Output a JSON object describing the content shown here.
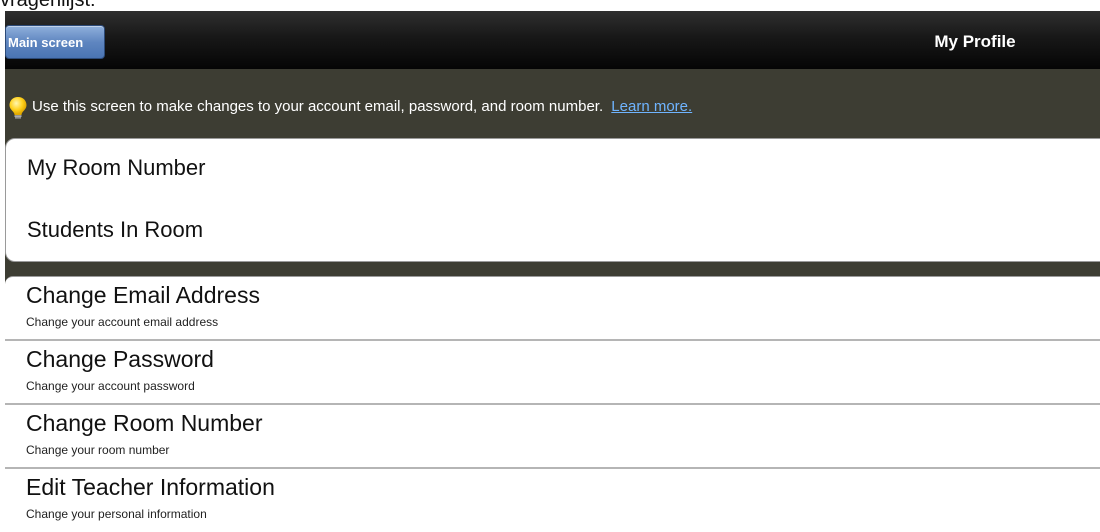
{
  "page_caption": "vragenlijst:",
  "nav": {
    "back_label": "Main screen",
    "title": "My Profile"
  },
  "info": {
    "text": "Use this screen to make changes to your account email, password, and room number.",
    "link": "Learn more.",
    "icon": "lightbulb-icon"
  },
  "room_group": {
    "rows": [
      {
        "label": "My Room Number"
      },
      {
        "label": "Students In Room"
      }
    ]
  },
  "settings": {
    "items": [
      {
        "title": "Change Email Address",
        "subtitle": "Change your account email address"
      },
      {
        "title": "Change Password",
        "subtitle": "Change your account password"
      },
      {
        "title": "Change Room Number",
        "subtitle": "Change your room number"
      },
      {
        "title": "Edit Teacher Information",
        "subtitle": "Change your personal information"
      }
    ]
  },
  "colors": {
    "nav_bg": "#0a0a0a",
    "info_bg": "#3d3d33",
    "button_blue": "#5f86c0",
    "link_blue": "#6fb4ff",
    "bulb_yellow": "#ffd21f"
  }
}
